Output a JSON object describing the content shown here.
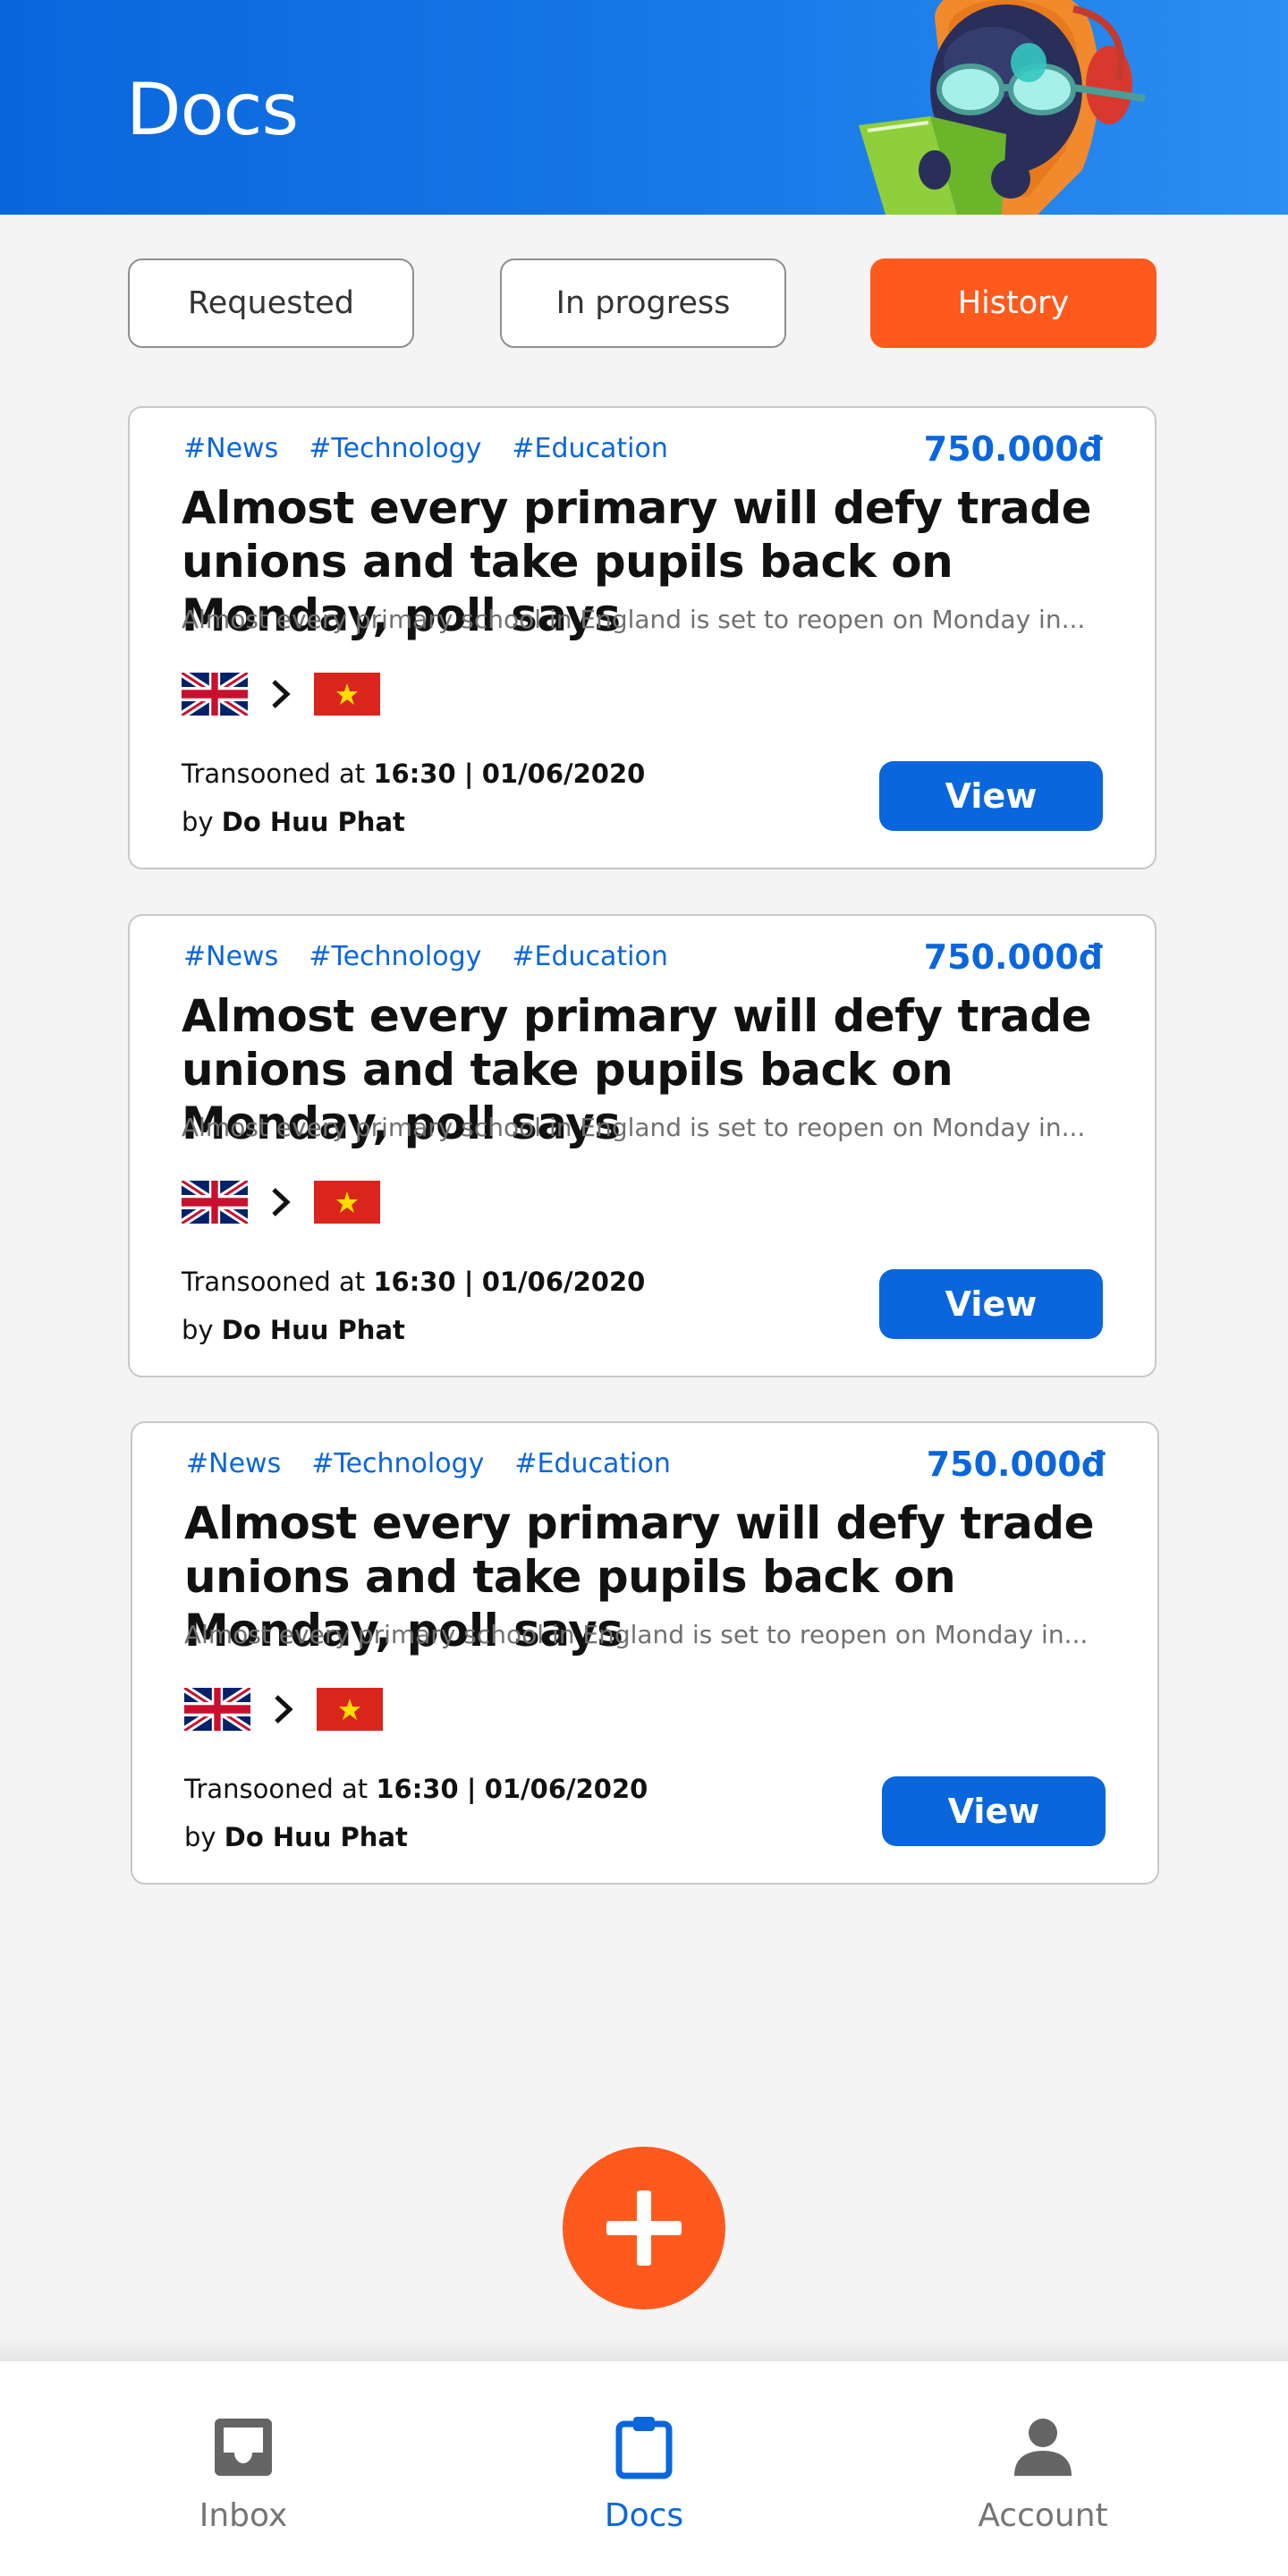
{
  "header": {
    "title": "Docs"
  },
  "tabs": [
    {
      "label": "Requested",
      "active": false
    },
    {
      "label": "In progress",
      "active": false
    },
    {
      "label": "History",
      "active": true
    }
  ],
  "cards": [
    {
      "tags": [
        "#News",
        "#Technology",
        "#Education"
      ],
      "price": "750.000đ",
      "title": "Almost every primary will defy trade unions and take pupils back on Monday, poll says",
      "summary": "Almost every primary school in England is set to reopen on Monday in...",
      "source_lang_icon": "uk-flag-icon",
      "target_lang_icon": "vietnam-flag-icon",
      "meta_prefix": "Transooned at",
      "time": "16:30",
      "separator": "|",
      "date": "01/06/2020",
      "by_prefix": "by",
      "author": "Do Huu Phat",
      "button": "View"
    },
    {
      "tags": [
        "#News",
        "#Technology",
        "#Education"
      ],
      "price": "750.000đ",
      "title": "Almost every primary will defy trade unions and take pupils back on Monday, poll says",
      "summary": "Almost every primary school in England is set to reopen on Monday in...",
      "source_lang_icon": "uk-flag-icon",
      "target_lang_icon": "vietnam-flag-icon",
      "meta_prefix": "Transooned at",
      "time": "16:30",
      "separator": "|",
      "date": "01/06/2020",
      "by_prefix": "by",
      "author": "Do Huu Phat",
      "button": "View"
    },
    {
      "tags": [
        "#News",
        "#Technology",
        "#Education"
      ],
      "price": "750.000đ",
      "title": "Almost every primary will defy trade unions and take pupils back on Monday, poll says",
      "summary": "Almost every primary school in England is set to reopen on Monday in...",
      "source_lang_icon": "uk-flag-icon",
      "target_lang_icon": "vietnam-flag-icon",
      "meta_prefix": "Transooned at",
      "time": "16:30",
      "separator": "|",
      "date": "01/06/2020",
      "by_prefix": "by",
      "author": "Do Huu Phat",
      "button": "View"
    }
  ],
  "fab": {
    "icon": "plus-icon"
  },
  "bottom_nav": [
    {
      "label": "Inbox",
      "icon": "inbox-icon",
      "active": false
    },
    {
      "label": "Docs",
      "icon": "clipboard-icon",
      "active": true
    },
    {
      "label": "Account",
      "icon": "person-icon",
      "active": false
    }
  ],
  "colors": {
    "primary": "#0a66dc",
    "accent": "#fe5a1d",
    "background": "#f4f4f4"
  }
}
